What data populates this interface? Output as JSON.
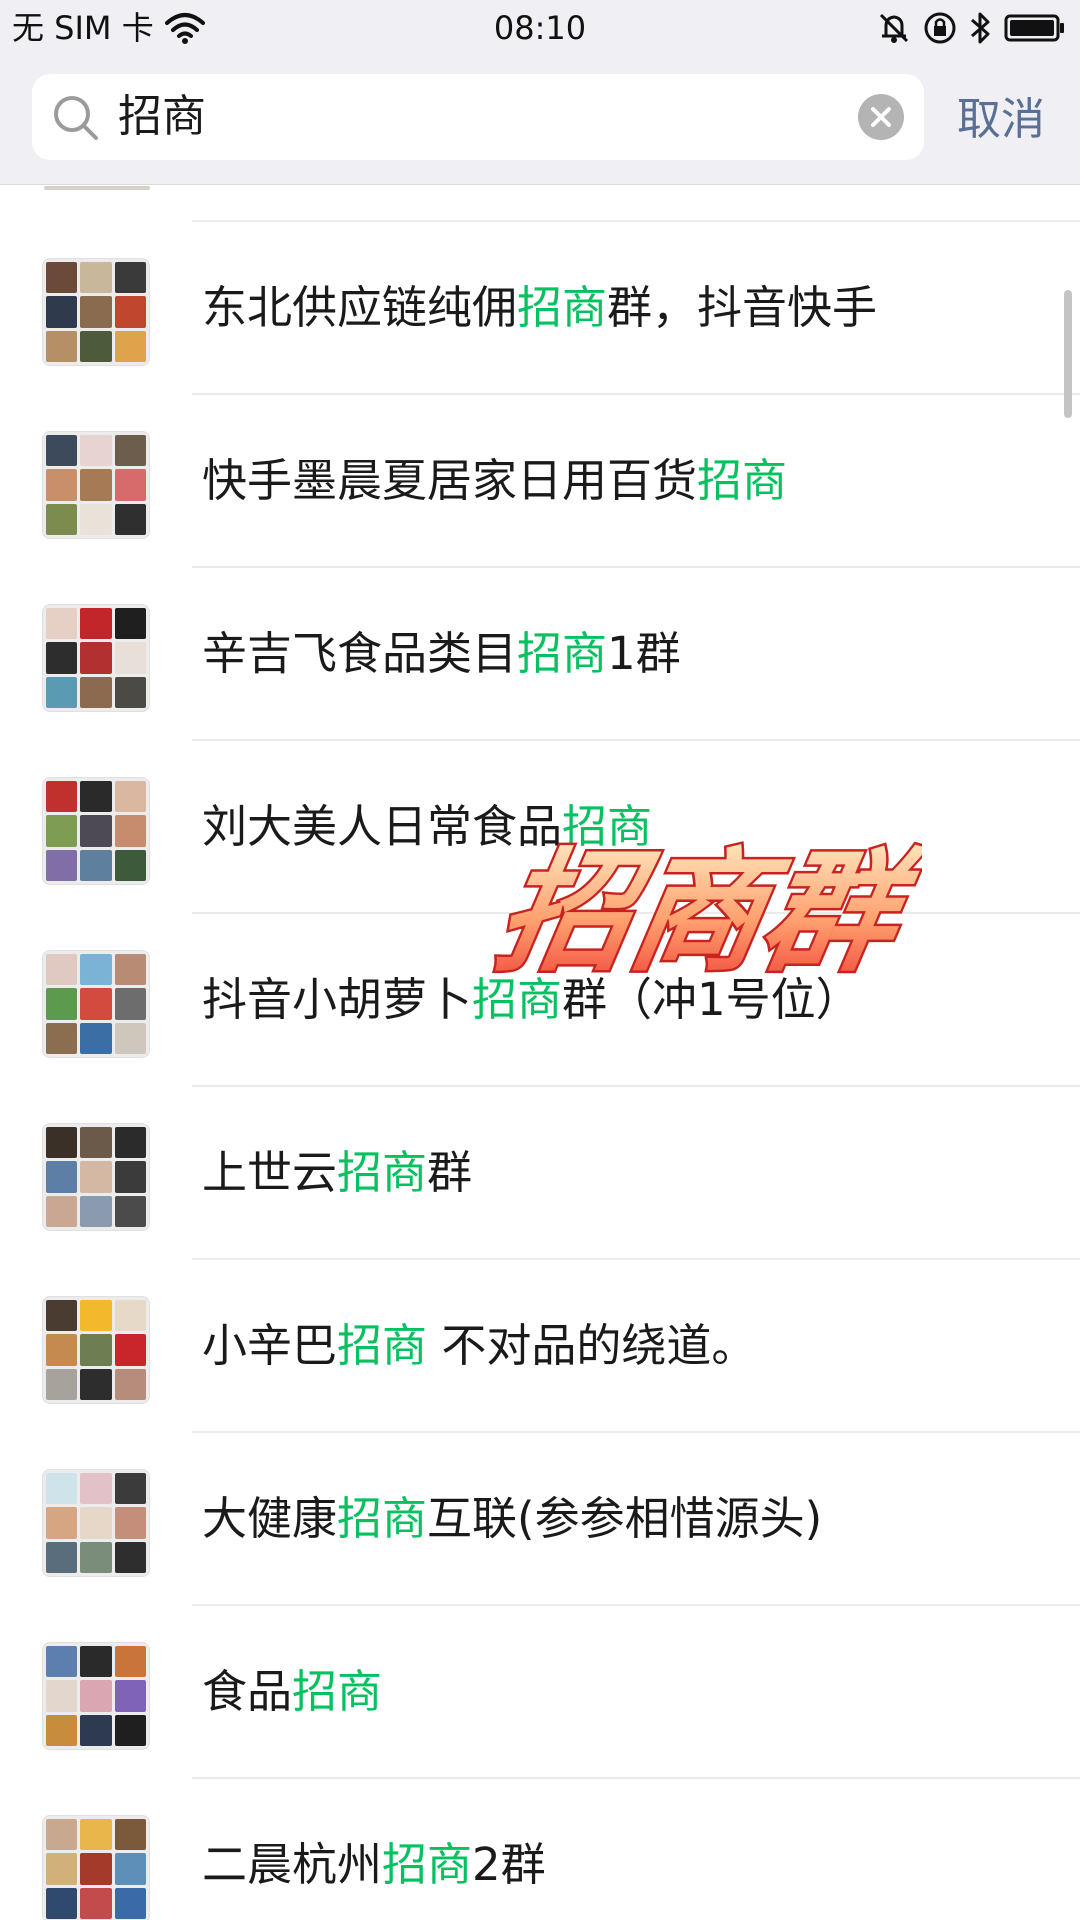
{
  "status_bar": {
    "carrier": "无 SIM 卡",
    "time": "08:10",
    "icons": [
      "wifi-icon",
      "mute-icon",
      "rotation-lock-icon",
      "bluetooth-icon",
      "battery-icon"
    ]
  },
  "search": {
    "query": "招商",
    "cancel_label": "取消"
  },
  "highlight_color": "#07c160",
  "results": [
    {
      "before": "东北供应链纯佣",
      "match": "招商",
      "after": "群，抖音快手",
      "avatar": [
        "#6b4a3a",
        "#c9b79c",
        "#3a3a3a",
        "#2f3b4d",
        "#8a6b4f",
        "#c0462e",
        "#b58f66",
        "#4d5a3b",
        "#e0a24a"
      ]
    },
    {
      "before": "快手墨晨夏居家日用百货",
      "match": "招商",
      "after": "",
      "avatar": [
        "#3c4a5c",
        "#e7d3cf",
        "#6d5d4d",
        "#c98f6b",
        "#a57a55",
        "#d76a6a",
        "#7c8b4e",
        "#e9e2d8",
        "#2f2f2f"
      ]
    },
    {
      "before": "辛吉飞食品类目",
      "match": "招商",
      "after": "1群",
      "avatar": [
        "#e6cfc4",
        "#c2262b",
        "#1f1f1f",
        "#2d2d2d",
        "#b33030",
        "#e8e0d8",
        "#5a9ab3",
        "#8b6a50",
        "#4c4a45"
      ]
    },
    {
      "before": "刘大美人日常食品",
      "match": "招商",
      "after": "",
      "avatar": [
        "#c0302c",
        "#2a2a2a",
        "#d9b7a0",
        "#7e9d53",
        "#4e4a55",
        "#c78c6e",
        "#7f6fa6",
        "#5f7f9e",
        "#3d5a3b"
      ]
    },
    {
      "before": "抖音小胡萝卜",
      "match": "招商",
      "after": "群（冲1号位）",
      "avatar": [
        "#e0c9c0",
        "#7ab3d6",
        "#b88b74",
        "#5c9a4e",
        "#d34a3f",
        "#6d6d6d",
        "#8b6e4f",
        "#3a6ea5",
        "#cfc6bc"
      ]
    },
    {
      "before": "上世云",
      "match": "招商",
      "after": "群",
      "avatar": [
        "#3a3028",
        "#6b5a4a",
        "#2b2b2b",
        "#5d7fa6",
        "#d5b8a4",
        "#3b3b3b",
        "#c9a793",
        "#8a9bb0",
        "#4b4b4b"
      ]
    },
    {
      "before": "小辛巴",
      "match": "招商",
      "after": " 不对品的绕道。",
      "avatar": [
        "#4a3c30",
        "#f2b92d",
        "#e6d9c8",
        "#c58a4f",
        "#6f7d52",
        "#c8262a",
        "#a7a29c",
        "#2d2d2d",
        "#b58d7a"
      ]
    },
    {
      "before": "大健康",
      "match": "招商",
      "after": "互联(参参相惜源头)",
      "avatar": [
        "#cfe3ea",
        "#e2c2c8",
        "#3b3b3b",
        "#d6a682",
        "#e6d7c9",
        "#c58e7a",
        "#5a6d7d",
        "#7a8c7a",
        "#2e2e2e"
      ]
    },
    {
      "before": "食品",
      "match": "招商",
      "after": "",
      "avatar": [
        "#5c7fb0",
        "#2a2a2a",
        "#c9743b",
        "#e3d6cc",
        "#d9a6b2",
        "#7f63b8",
        "#c78c3c",
        "#2d3a4f",
        "#1f1f1f"
      ]
    },
    {
      "before": "二晨杭州",
      "match": "招商",
      "after": "2群",
      "avatar": [
        "#c9a890",
        "#e8b64a",
        "#7a5a3a",
        "#d1b07a",
        "#a33a2a",
        "#5e8fb8",
        "#2f4a6e",
        "#c44b4b",
        "#3a6aa8"
      ]
    }
  ],
  "overlay_title": "招商群"
}
